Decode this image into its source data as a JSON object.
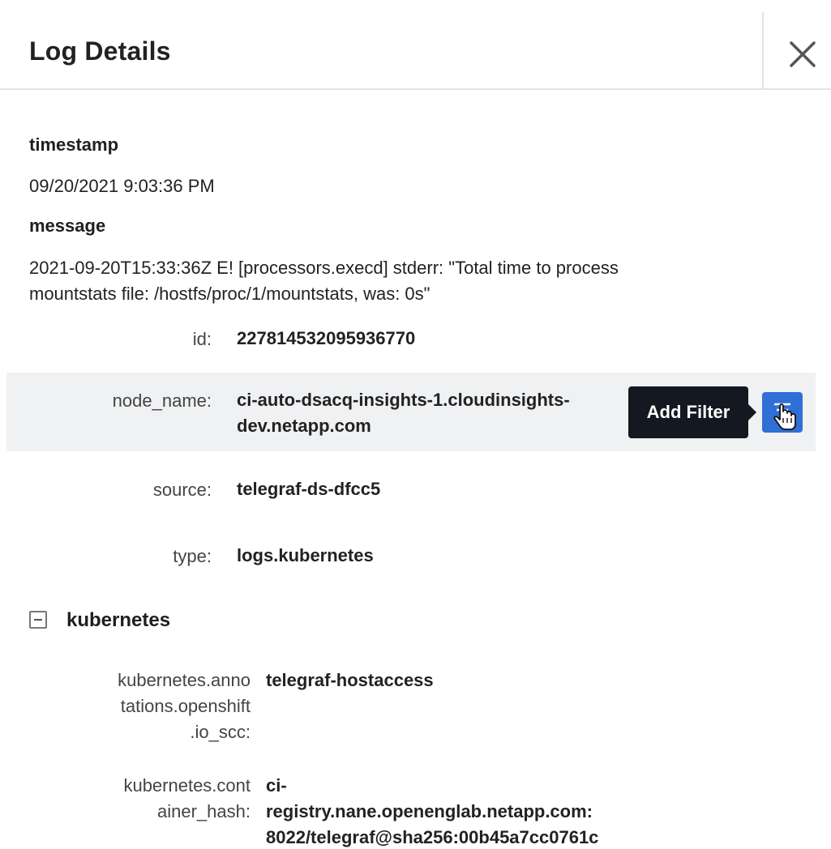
{
  "header": {
    "title": "Log Details"
  },
  "fields": {
    "timestamp_label": "timestamp",
    "timestamp_value": "09/20/2021 9:03:36 PM",
    "message_label": "message",
    "message_value_line1": "2021-09-20T15:33:36Z E! [processors.execd] stderr: \"Total time to process",
    "message_value_line2": "mountstats file: /hostfs/proc/1/mountstats, was: 0s\""
  },
  "attributes": [
    {
      "key": "id:",
      "value_line1": "227814532095936770",
      "value_line2": ""
    },
    {
      "key": "node_name:",
      "value_line1": "ci-auto-dsacq-insights-1.cloudinsights-",
      "value_line2": "dev.netapp.com"
    },
    {
      "key": "source:",
      "value_line1": "telegraf-ds-dfcc5",
      "value_line2": ""
    },
    {
      "key": "type:",
      "value_line1": "logs.kubernetes",
      "value_line2": ""
    }
  ],
  "tooltip": {
    "text": "Add Filter"
  },
  "kubernetes": {
    "section_title": "kubernetes",
    "rows": [
      {
        "key_lines": [
          "kubernetes.anno",
          "tations.openshift",
          ".io_scc:"
        ],
        "value_lines": [
          "telegraf-hostaccess"
        ]
      },
      {
        "key_lines": [
          "kubernetes.cont",
          "ainer_hash:"
        ],
        "value_lines": [
          "ci-",
          "registry.nane.openenglab.netapp.com:",
          "8022/telegraf@sha256:00b45a7cc0761c"
        ]
      }
    ]
  },
  "colors": {
    "accent": "#2f6fd6",
    "tooltip_bg": "#141820",
    "highlight_row": "#f0f1f3"
  },
  "icons": {
    "close": "close-icon",
    "filter": "filter-icon",
    "cursor": "hand-cursor-icon",
    "collapse": "minus-square-icon"
  }
}
